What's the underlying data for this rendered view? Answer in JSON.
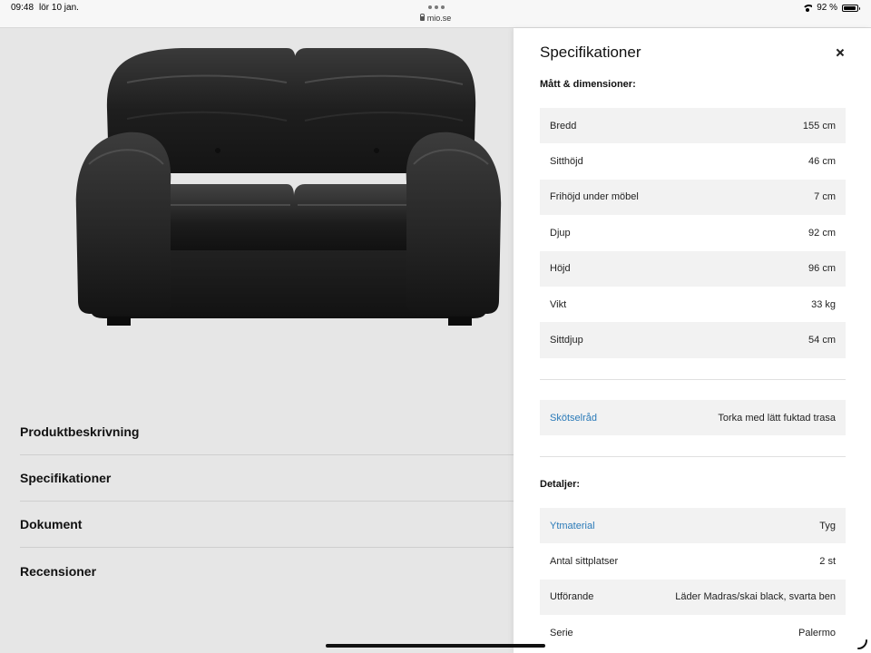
{
  "status_bar": {
    "time": "09:48",
    "date": "lör 10 jan.",
    "url": "mio.se",
    "battery": "92 %"
  },
  "product": {
    "sections": [
      "Produktbeskrivning",
      "Specifikationer",
      "Dokument",
      "Recensioner"
    ]
  },
  "drawer": {
    "title": "Specifikationer",
    "dimensions_heading": "Mått & dimensioner:",
    "dimensions": [
      {
        "label": "Bredd",
        "value": "155 cm"
      },
      {
        "label": "Sitthöjd",
        "value": "46 cm"
      },
      {
        "label": "Frihöjd under möbel",
        "value": "7 cm"
      },
      {
        "label": "Djup",
        "value": "92 cm"
      },
      {
        "label": "Höjd",
        "value": "96 cm"
      },
      {
        "label": "Vikt",
        "value": "33 kg"
      },
      {
        "label": "Sittdjup",
        "value": "54 cm"
      }
    ],
    "care": {
      "label": "Skötselråd",
      "value": "Torka med lätt fuktad trasa"
    },
    "details_heading": "Detaljer:",
    "details": [
      {
        "label": "Ytmaterial",
        "value": "Tyg",
        "link": true
      },
      {
        "label": "Antal sittplatser",
        "value": "2 st",
        "link": false
      },
      {
        "label": "Utförande",
        "value": "Läder Madras/skai black, svarta ben",
        "link": false
      },
      {
        "label": "Serie",
        "value": "Palermo",
        "link": false
      }
    ]
  },
  "colors": {
    "link": "#2a7ab8",
    "row_alt": "#f2f2f2",
    "page_bg": "#e6e6e6"
  },
  "icons": {
    "close": "close-icon",
    "wifi": "wifi-icon",
    "battery": "battery-icon",
    "lock": "lock-icon"
  }
}
